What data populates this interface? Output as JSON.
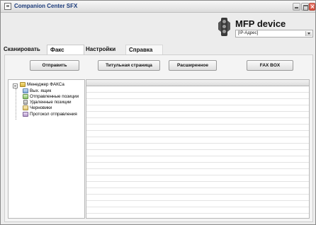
{
  "window": {
    "title": "Companion Center SFX"
  },
  "header": {
    "device_title": "MFP device",
    "ip_select_value": "[IP-Адрес]"
  },
  "tabs": [
    {
      "label": "Сканировать"
    },
    {
      "label": "Факс",
      "selected": true
    },
    {
      "label": "Настройки"
    },
    {
      "label": "Справка"
    }
  ],
  "toolbar": {
    "send_label": "Отправить",
    "cover_label": "Титульная страница",
    "advanced_label": "Расширенное",
    "faxbox_label": "FAX BOX"
  },
  "tree": {
    "root": {
      "label": "Менеджер ФАКСа",
      "icon": "folder-icon",
      "expanded": true
    },
    "items": [
      {
        "label": "Вых. ящик",
        "icon": "outbox-icon"
      },
      {
        "label": "Отправленные позиции",
        "icon": "sent-icon"
      },
      {
        "label": "Удаленные позиции",
        "icon": "trash-icon"
      },
      {
        "label": "Черновики",
        "icon": "drafts-icon"
      },
      {
        "label": "Протокол отправления",
        "icon": "log-icon"
      }
    ]
  },
  "colors": {
    "title_text": "#1a3a7a",
    "window_bg": "#ececec",
    "close_button": "#d24a3a"
  }
}
